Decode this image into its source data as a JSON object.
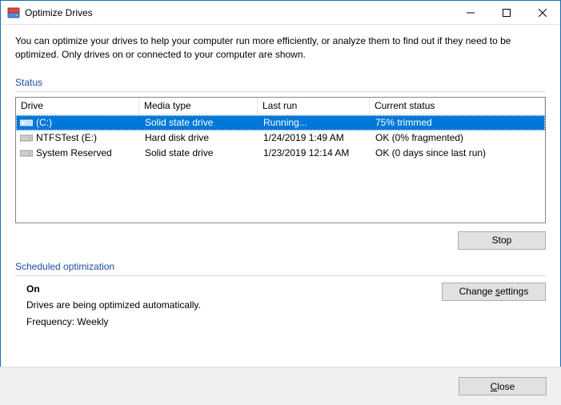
{
  "window": {
    "title": "Optimize Drives"
  },
  "intro": "You can optimize your drives to help your computer run more efficiently, or analyze them to find out if they need to be optimized. Only drives on or connected to your computer are shown.",
  "status_label": "Status",
  "columns": {
    "drive": "Drive",
    "media": "Media type",
    "last": "Last run",
    "status": "Current status"
  },
  "drives": [
    {
      "name": "(C:)",
      "media": "Solid state drive",
      "last": "Running...",
      "status": "75% trimmed",
      "icon": "ssd",
      "selected": true
    },
    {
      "name": "NTFSTest (E:)",
      "media": "Hard disk drive",
      "last": "1/24/2019 1:49 AM",
      "status": "OK (0% fragmented)",
      "icon": "hdd",
      "selected": false
    },
    {
      "name": "System Reserved",
      "media": "Solid state drive",
      "last": "1/23/2019 12:14 AM",
      "status": "OK (0 days since last run)",
      "icon": "hdd",
      "selected": false
    }
  ],
  "buttons": {
    "stop": "Stop",
    "change_settings_pre": "Change ",
    "change_settings_u": "s",
    "change_settings_post": "ettings",
    "close_u": "C",
    "close_post": "lose"
  },
  "sched": {
    "label": "Scheduled optimization",
    "on": "On",
    "desc": "Drives are being optimized automatically.",
    "freq": "Frequency: Weekly"
  }
}
